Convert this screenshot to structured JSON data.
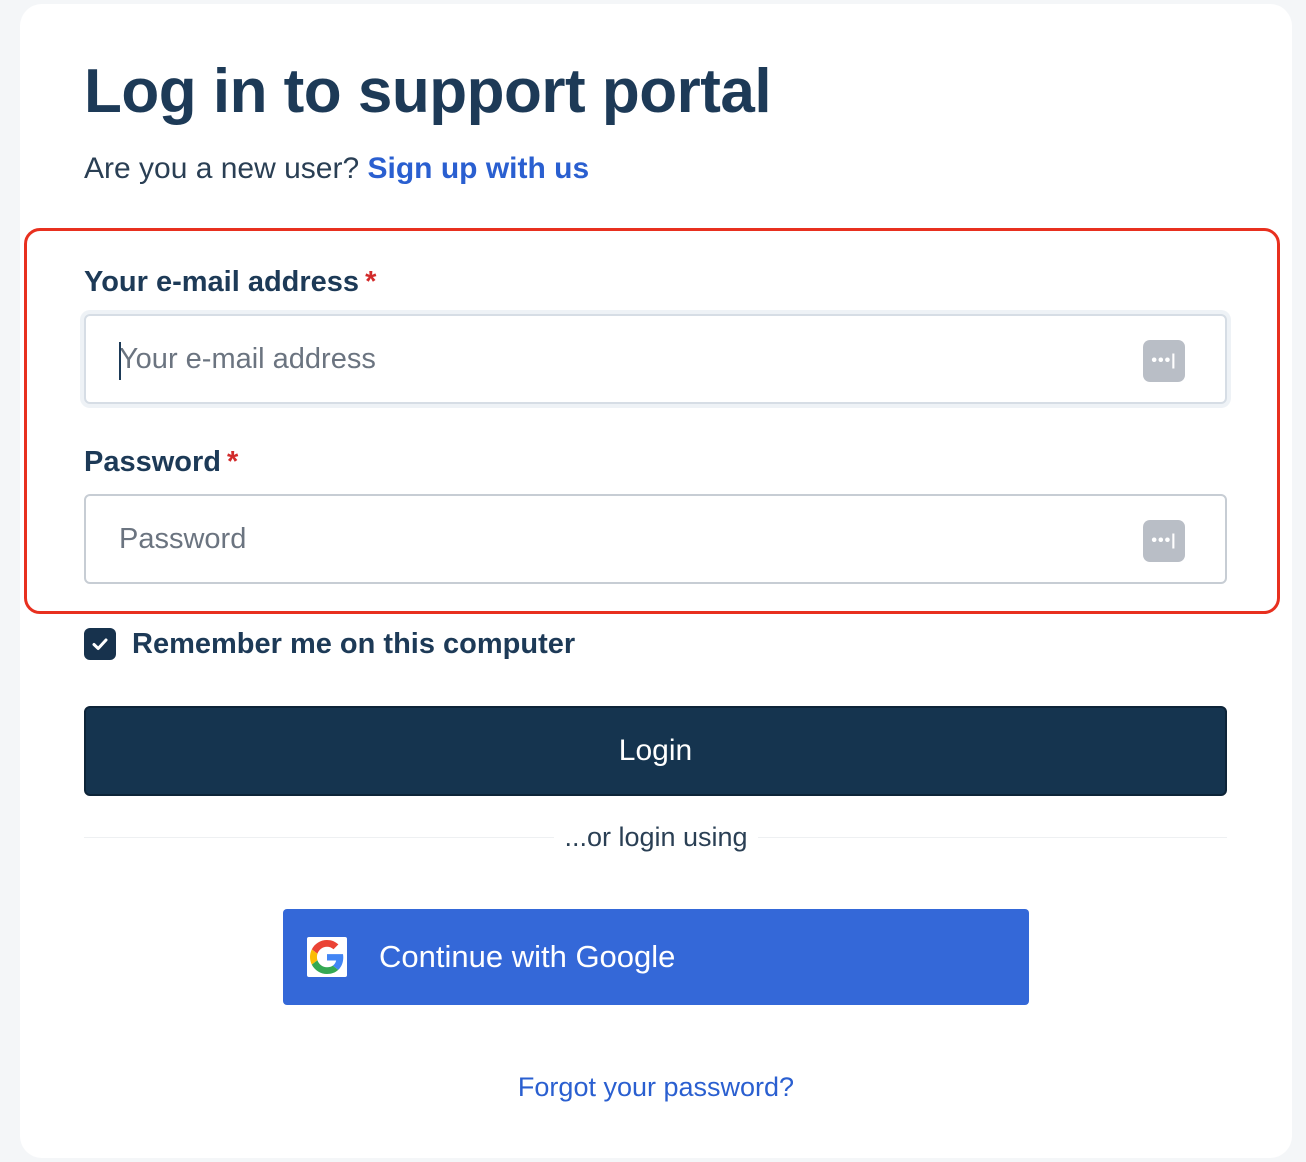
{
  "page": {
    "title": "Log in to support portal",
    "new_user_prompt": "Are you a new user?",
    "signup_link": "Sign up with us"
  },
  "form": {
    "email": {
      "label": "Your e-mail address",
      "required_marker": "*",
      "placeholder": "Your e-mail address",
      "value": ""
    },
    "password": {
      "label": "Password",
      "required_marker": "*",
      "placeholder": "Password",
      "value": ""
    },
    "password_manager_icon": "password-manager-icon",
    "remember_me": {
      "label": "Remember me on this computer",
      "checked": true
    },
    "login_button": "Login"
  },
  "alt_login": {
    "divider_text": "...or login using",
    "google_button": "Continue with Google"
  },
  "footer": {
    "forgot_password": "Forgot your password?"
  },
  "colors": {
    "title": "#1d3a57",
    "link": "#2a5fd0",
    "required": "#d22b2b",
    "login_button_bg": "#15344f",
    "google_button_bg": "#3468d8",
    "highlight_border": "#e8301f"
  }
}
